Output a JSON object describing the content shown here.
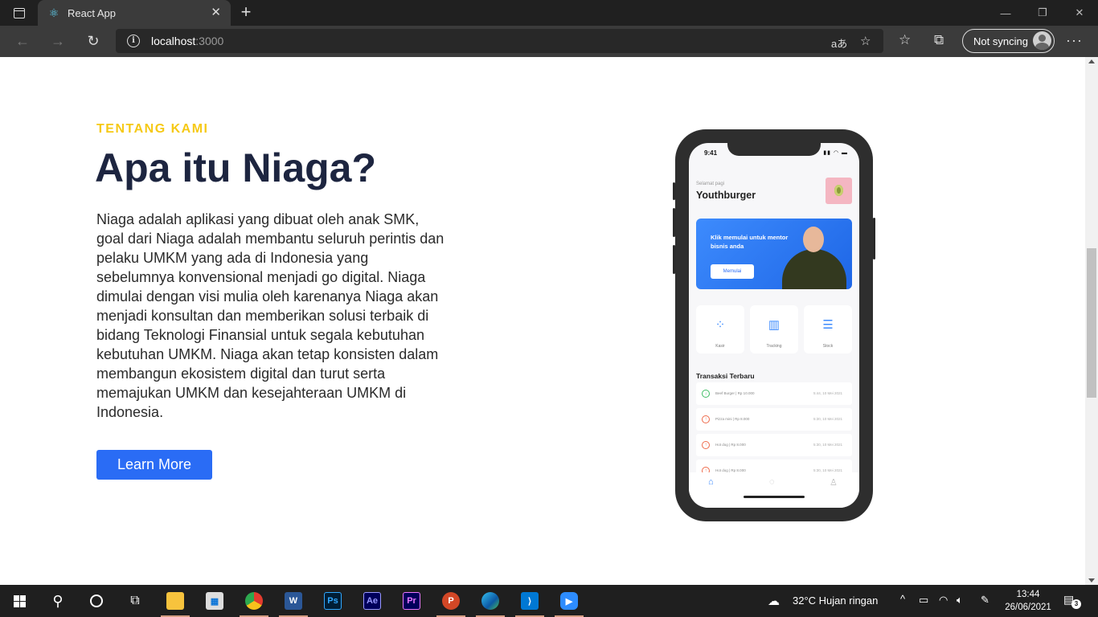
{
  "browser": {
    "tab_title": "React App",
    "url_host": "localhost",
    "url_port": ":3000",
    "read_aloud_icon": "read-aloud-icon",
    "sync_label": "Not syncing"
  },
  "page": {
    "eyebrow": "TENTANG KAMI",
    "headline": "Apa itu Niaga?",
    "body": "Niaga adalah aplikasi yang dibuat oleh anak SMK, goal dari Niaga adalah membantu seluruh perintis dan pelaku UMKM yang ada di Indonesia yang sebelumnya konvensional menjadi go digital. Niaga dimulai dengan visi mulia oleh karenanya Niaga akan menjadi konsultan dan memberikan solusi terbaik di bidang Teknologi Finansial untuk segala kebutuhan kebutuhan UMKM. Niaga akan tetap konsisten dalam membangun ekosistem digital dan turut serta memajukan UMKM dan kesejahteraan UMKM di Indonesia.",
    "cta_label": "Learn More",
    "colors": {
      "eyebrow": "#f6c915",
      "headline": "#1d2540",
      "cta": "#2a6cf5"
    }
  },
  "phone": {
    "time": "9:41",
    "greeting": "Selamat pagi",
    "store_name": "Youthburger",
    "promo_text": "Klik memulai untuk mentor bisnis anda",
    "promo_button": "Memulai",
    "menu": [
      {
        "label": "Kasir",
        "icon": "grid-icon"
      },
      {
        "label": "Tracking",
        "icon": "chart-icon"
      },
      {
        "label": "Stock",
        "icon": "list-icon"
      }
    ],
    "transactions_title": "Transaksi Terbaru",
    "transactions": [
      {
        "name": "Beef Burger | Rp 10.000",
        "date": "5:44, 10 Mei 2021",
        "direction": "in"
      },
      {
        "name": "Pizza mini | Rp 8.000",
        "date": "5:30, 10 Mei 2021",
        "direction": "out"
      },
      {
        "name": "Hot dog | Rp 8.000",
        "date": "5:30, 10 Mei 2021",
        "direction": "out"
      },
      {
        "name": "Hot dog | Rp 8.000",
        "date": "5:30, 10 Mei 2021",
        "direction": "out"
      }
    ]
  },
  "taskbar": {
    "weather": "32°C  Hujan ringan",
    "time": "13:44",
    "date": "26/06/2021",
    "notification_count": "3",
    "apps": [
      "file-explorer",
      "microsoft-store",
      "chrome",
      "word",
      "photoshop",
      "after-effects",
      "premiere",
      "powerpoint",
      "edge",
      "vscode",
      "zoom"
    ]
  }
}
